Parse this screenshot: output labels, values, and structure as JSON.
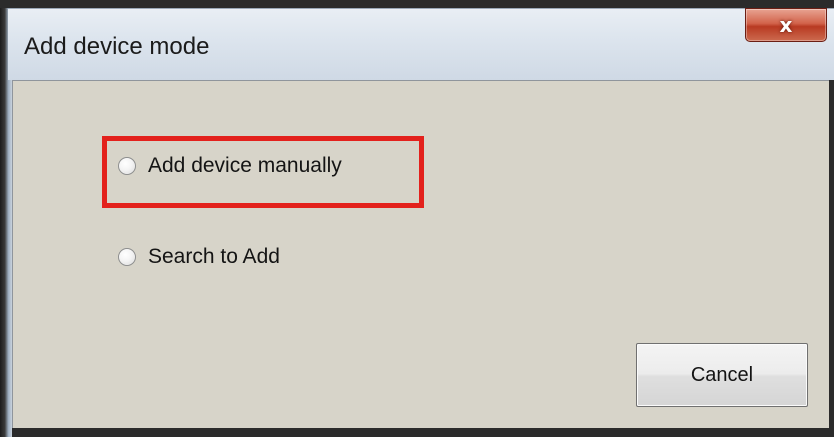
{
  "window": {
    "title": "Add device mode",
    "close_glyph": "x"
  },
  "options": [
    {
      "label": "Add device manually",
      "selected": false,
      "highlighted": true
    },
    {
      "label": "Search to Add",
      "selected": false,
      "highlighted": false
    }
  ],
  "buttons": {
    "cancel_label": "Cancel"
  },
  "colors": {
    "highlight": "#e3211c",
    "dialog_background": "#d7d4c9",
    "close_button": "#c9452c"
  }
}
